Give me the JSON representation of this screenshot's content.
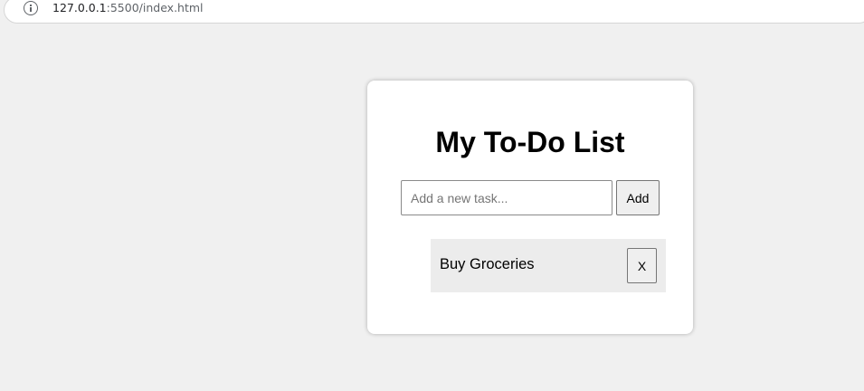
{
  "browser": {
    "url_host": "127.0.0.1",
    "url_rest": ":5500/index.html"
  },
  "app": {
    "title": "My To-Do List",
    "input": {
      "placeholder": "Add a new task...",
      "value": ""
    },
    "add_label": "Add",
    "tasks": [
      {
        "text": "Buy Groceries",
        "remove_label": "X"
      }
    ]
  }
}
